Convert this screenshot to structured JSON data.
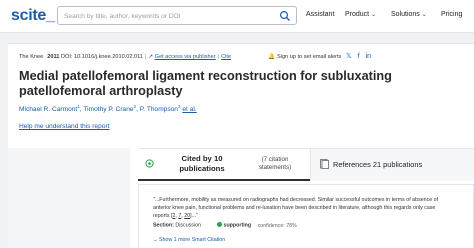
{
  "header": {
    "logo": "scite_",
    "search_placeholder": "Search by title, author, keywords or DOI",
    "nav": {
      "assistant": "Assistant",
      "product": "Product",
      "solutions": "Solutions",
      "pricing": "Pricing"
    }
  },
  "paper": {
    "journal": "The Knee",
    "year": "2011",
    "doi": "DOI: 10.1016/j.knee.2010.02.011",
    "access_link": "Get access via publisher",
    "cite": "Cite",
    "alert": "Sign up to set email alerts",
    "title": "Medial patellofemoral ligament reconstruction for subluxating patellofemoral arthroplasty",
    "authors": [
      {
        "name": "Michael R. Carmont",
        "sup": "1"
      },
      {
        "name": "Timothy P. Crane",
        "sup": "2"
      },
      {
        "name": "P. Thompson",
        "sup": "3"
      }
    ],
    "et_al": "et al.",
    "help_link": "Help me understand this report"
  },
  "tabs": {
    "cited_by": "Cited by 10 publications",
    "citation_statements": "(7 citation statements)",
    "references": "References 21 publications"
  },
  "snippet": {
    "quote_start": "\"...Furthermore, mobility as measured on radiographs had decreased. Similar successful outcomes in terms of absence of anterior knee pain, functional problems and re-luxation have been described in literature, although this regards only case reports [",
    "refs": [
      "2",
      "7",
      "20"
    ],
    "quote_end": "]...\"",
    "section_label": "Section:",
    "section": "Discussion",
    "supporting": "supporting",
    "confidence": "confidence: 78%",
    "more": "Show 1 more Smart Citation"
  },
  "colors": {
    "brand": "#1a5dab",
    "supporting": "#2e9e4f"
  }
}
